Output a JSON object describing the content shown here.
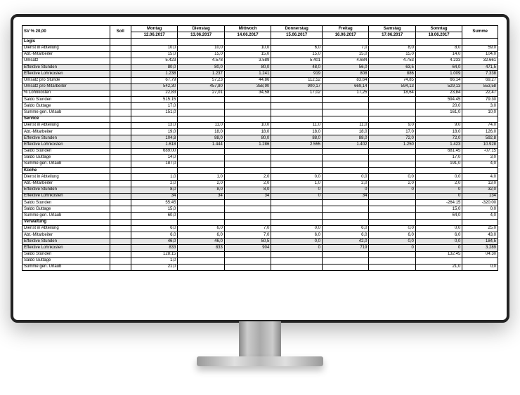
{
  "header": {
    "sv_label": "SV % 20,00",
    "soll_label": "Soll",
    "summe_label": "Summe",
    "days": [
      "Montag",
      "Dienstag",
      "Mittwoch",
      "Donnerstag",
      "Freitag",
      "Samstag",
      "Sonntag"
    ],
    "dates": [
      "12.06.2017",
      "13.06.2017",
      "14.06.2017",
      "15.06.2017",
      "16.06.2017",
      "17.06.2017",
      "18.06.2017"
    ]
  },
  "sections": [
    {
      "name": "Logis",
      "rows": [
        {
          "label": "Dienst in Abteilung",
          "d": [
            "10,0",
            "10,0",
            "10,0",
            "6,0",
            "7,0",
            "8,0",
            "8,0"
          ],
          "sum": "59,0",
          "shaded": false
        },
        {
          "label": "Abt.-Mitarbeiter",
          "d": [
            "15,0",
            "15,0",
            "15,0",
            "15,0",
            "15,0",
            "15,0",
            "14,0"
          ],
          "sum": "104,0",
          "shaded": false
        },
        {
          "label": "Umsatz",
          "d": [
            "5.423",
            "4.578",
            "3.589",
            "5.401",
            "4.684",
            "4.753",
            "4.233"
          ],
          "sum": "32.661",
          "shaded": false
        },
        {
          "label": "Effektive Stunden",
          "d": [
            "80,0",
            "80,0",
            "80,0",
            "48,0",
            "56,0",
            "63,5",
            "64,0"
          ],
          "sum": "471,5",
          "shaded": true
        },
        {
          "label": "Effektive Lohnkosten",
          "d": [
            "1.238",
            "1.237",
            "1.241",
            "919",
            "808",
            "886",
            "1.009"
          ],
          "sum": "7.338",
          "shaded": true
        },
        {
          "label": "Umsatz pro Stunde",
          "d": [
            "67,79",
            "57,23",
            "44,86",
            "112,52",
            "83,64",
            "74,85",
            "66,14"
          ],
          "sum": "69,27",
          "shaded": false
        },
        {
          "label": "Umsatz pro Mitarbeiter",
          "d": [
            "542,30",
            "457,80",
            "358,90",
            "900,17",
            "669,14",
            "594,13",
            "529,13"
          ],
          "sum": "553,58",
          "shaded": true
        },
        {
          "label": "% Lohnkosten",
          "d": [
            "22,83",
            "27,01",
            "34,58",
            "17,02",
            "17,25",
            "18,64",
            "23,84"
          ],
          "sum": "22,47",
          "shaded": false
        },
        {
          "label": "Saldo Stunden",
          "d": [
            "515:15",
            "",
            "",
            "",
            "",
            "",
            "594:45"
          ],
          "sum": "79:30",
          "shaded": false
        },
        {
          "label": "Saldo Guttage",
          "d": [
            "17,0",
            "",
            "",
            "",
            "",
            "",
            "20,0"
          ],
          "sum": "3,0",
          "shaded": false
        },
        {
          "label": "Summe gen. Urlaub",
          "d": [
            "151,0",
            "",
            "",
            "",
            "",
            "",
            "161,0"
          ],
          "sum": "10,0",
          "shaded": false
        }
      ]
    },
    {
      "name": "Service",
      "rows": [
        {
          "label": "Dienst in Abteilung",
          "d": [
            "13,0",
            "11,0",
            "10,0",
            "11,0",
            "11,0",
            "9,0",
            "9,0"
          ],
          "sum": "74,0",
          "shaded": false
        },
        {
          "label": "Abt.-Mitarbeiter",
          "d": [
            "19,0",
            "18,0",
            "18,0",
            "18,0",
            "18,0",
            "17,0",
            "18,0"
          ],
          "sum": "126,0",
          "shaded": false
        },
        {
          "label": "Effektive Stunden",
          "d": [
            "104,8",
            "88,0",
            "80,0",
            "88,0",
            "88,0",
            "72,0",
            "72,0"
          ],
          "sum": "592,8",
          "shaded": true
        },
        {
          "label": "Effektive Lohnkosten",
          "d": [
            "1.618",
            "1.444",
            "1.286",
            "2.555",
            "1.402",
            "1.250",
            "1.423"
          ],
          "sum": "10.928",
          "shaded": true
        },
        {
          "label": "Saldo Stunden",
          "d": [
            "689:00",
            "",
            "",
            "",
            "",
            "",
            "681:45"
          ],
          "sum": "-07:15",
          "shaded": false
        },
        {
          "label": "Saldo Guttage",
          "d": [
            "14,0",
            "",
            "",
            "",
            "",
            "",
            "17,0"
          ],
          "sum": "3,0",
          "shaded": false
        },
        {
          "label": "Summe gen. Urlaub",
          "d": [
            "187,0",
            "",
            "",
            "",
            "",
            "",
            "191,0"
          ],
          "sum": "4,0",
          "shaded": false
        }
      ]
    },
    {
      "name": "Küche",
      "rows": [
        {
          "label": "Dienst in Abteilung",
          "d": [
            "1,0",
            "1,0",
            "2,0",
            "0,0",
            "0,0",
            "0,0",
            "0,0"
          ],
          "sum": "4,0",
          "shaded": false
        },
        {
          "label": "Abt.-Mitarbeiter",
          "d": [
            "2,0",
            "2,0",
            "2,0",
            "1,0",
            "2,0",
            "2,0",
            "2,0"
          ],
          "sum": "13,0",
          "shaded": false
        },
        {
          "label": "Effektive Stunden",
          "d": [
            "8,0",
            "8,0",
            "8,0",
            "0",
            "0",
            "0",
            "0"
          ],
          "sum": "32,0",
          "shaded": true
        },
        {
          "label": "Effektive Lohnkosten",
          "d": [
            "34",
            "34",
            "34",
            "0",
            "34",
            "",
            "0"
          ],
          "sum": "134",
          "shaded": true
        },
        {
          "label": "Saldo Stunden",
          "d": [
            "55:45",
            "",
            "",
            "",
            "",
            "",
            "-264:15"
          ],
          "sum": "-320:00",
          "shaded": false
        },
        {
          "label": "Saldo Guttage",
          "d": [
            "15,0",
            "",
            "",
            "",
            "",
            "",
            "15,0"
          ],
          "sum": "0,0",
          "shaded": false
        },
        {
          "label": "Summe gen. Urlaub",
          "d": [
            "60,0",
            "",
            "",
            "",
            "",
            "",
            "64,0"
          ],
          "sum": "4,0",
          "shaded": false
        }
      ]
    },
    {
      "name": "Verwaltung",
      "rows": [
        {
          "label": "Dienst in Abteilung",
          "d": [
            "6,0",
            "6,0",
            "7,0",
            "0,0",
            "6,0",
            "0,0",
            "0,0"
          ],
          "sum": "25,0",
          "shaded": false
        },
        {
          "label": "Abt.-Mitarbeiter",
          "d": [
            "6,0",
            "6,0",
            "7,0",
            "6,0",
            "6,0",
            "6,0",
            "6,0"
          ],
          "sum": "43,0",
          "shaded": false
        },
        {
          "label": "Effektive Stunden",
          "d": [
            "46,0",
            "46,0",
            "50,5",
            "0,0",
            "42,0",
            "0,0",
            "0,0"
          ],
          "sum": "184,5",
          "shaded": true
        },
        {
          "label": "Effektive Lohnkosten",
          "d": [
            "833",
            "833",
            "904",
            "0",
            "719",
            "0",
            "0"
          ],
          "sum": "3.289",
          "shaded": true
        },
        {
          "label": "Saldo Stunden",
          "d": [
            "128:15",
            "",
            "",
            "",
            "",
            "",
            "132:45"
          ],
          "sum": "04:30",
          "shaded": false
        },
        {
          "label": "Saldo Guttage",
          "d": [
            "1,0",
            "",
            "",
            "",
            "",
            "",
            "",
            "",
            ""
          ],
          "sum": "",
          "shaded": false
        },
        {
          "label": "Summe gen. Urlaub",
          "d": [
            "21,0",
            "",
            "",
            "",
            "",
            "",
            "21,0"
          ],
          "sum": "0,0",
          "shaded": false
        }
      ]
    }
  ]
}
